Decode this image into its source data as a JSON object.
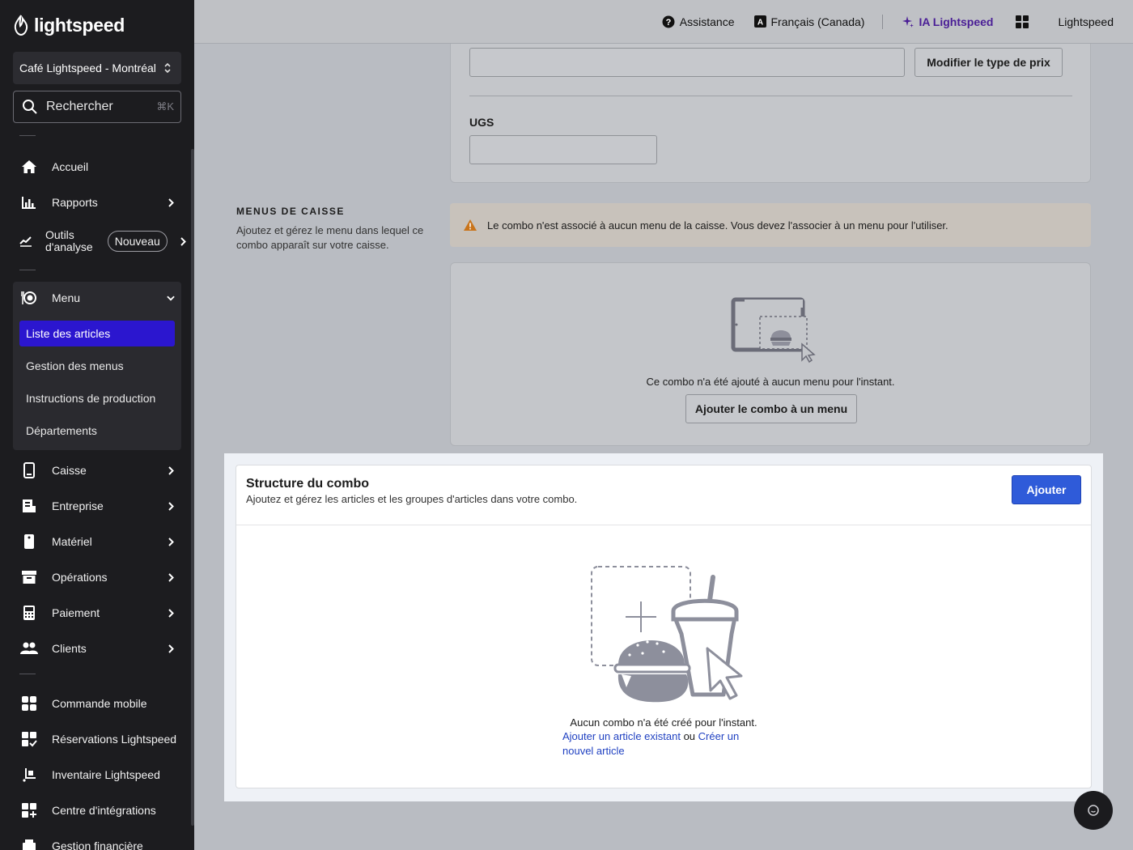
{
  "sidebar": {
    "logo": "lightspeed",
    "store": "Café Lightspeed - Montréal",
    "search": {
      "label": "Rechercher",
      "shortcut": "⌘K"
    },
    "nav": {
      "accueil": "Accueil",
      "rapports": "Rapports",
      "outils_line1": "Outils",
      "outils_line2": "d'analyse",
      "nouveau_badge": "Nouveau",
      "menu": "Menu",
      "caisse": "Caisse",
      "entreprise": "Entreprise",
      "materiel": "Matériel",
      "operations": "Opérations",
      "paiement": "Paiement",
      "clients": "Clients",
      "commande_mobile": "Commande mobile",
      "reservations": "Réservations Lightspeed",
      "inventaire": "Inventaire Lightspeed",
      "integrations": "Centre d'intégrations",
      "gestion_financiere": "Gestion financière"
    },
    "menu_sub": {
      "liste": "Liste des articles",
      "gestion": "Gestion des menus",
      "instructions": "Instructions de production",
      "departements": "Départements"
    }
  },
  "topbar": {
    "assistance": "Assistance",
    "language": "Français (Canada)",
    "ai": "IA Lightspeed",
    "account": "Lightspeed"
  },
  "pricing": {
    "modify_button": "Modifier le type de prix",
    "ugs_label": "UGS"
  },
  "menus_caisse": {
    "title": "MENUS DE CAISSE",
    "desc": "Ajoutez et gérez le menu dans lequel ce combo apparaît sur votre caisse.",
    "warning": "Le combo n'est associé à aucun menu de la caisse. Vous devez l'associer à un menu pour l'utiliser.",
    "empty_text": "Ce combo n'a été ajouté à aucun menu pour l'instant.",
    "add_button": "Ajouter le combo à un menu"
  },
  "combo": {
    "title": "Structure du combo",
    "subtitle": "Ajoutez et gérez les articles et les groupes d'articles dans votre combo.",
    "add_button": "Ajouter",
    "empty_text": "Aucun combo n'a été créé pour l'instant.",
    "link_existing": "Ajouter un article existant",
    "link_or": " ou ",
    "link_new": "Créer un nouvel article"
  }
}
